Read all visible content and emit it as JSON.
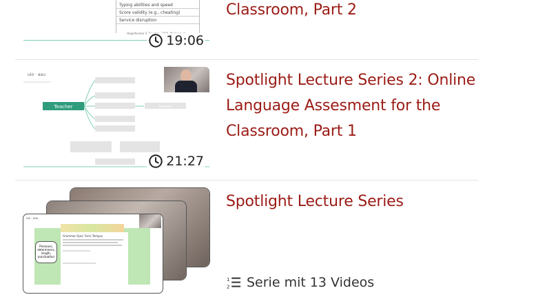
{
  "items": [
    {
      "title_lines": [
        "Classroom, Part 2"
      ],
      "duration": "19:06",
      "thumb_text": {
        "rows": [
          "Typing abilities and speed",
          "Score validity (e.g., cheating)",
          "Service disruption"
        ],
        "cite": "Hegelheimer & Douglas, 2008, Phelps & al."
      }
    },
    {
      "title_lines": [
        "Spotlight Lecture Series 2: Online",
        "Language Assesment for the",
        "Classroom, Part 1"
      ],
      "duration": "21:27",
      "thumb_text": {
        "center_node": "Teacher",
        "right_node": "Learner",
        "nodes": [
          "Institution",
          "Assessment",
          "Parents",
          "School/Partner",
          "Interaction",
          "Communicative Competence",
          "Language ability",
          "Language Test"
        ]
      }
    },
    {
      "title_lines": [
        "Spotlight Lecture Series"
      ],
      "series_label": "Serie mit 13 Videos",
      "thumb_text": {
        "page_title": "Grammar Quiz: Ferie Tempus",
        "bubble": "Pronouns, determiners, length, punctuation"
      }
    }
  ],
  "colors": {
    "title": "#9b1b15",
    "teacher_node": "#2e9c7d",
    "green_panel": "#bfe6b5"
  }
}
